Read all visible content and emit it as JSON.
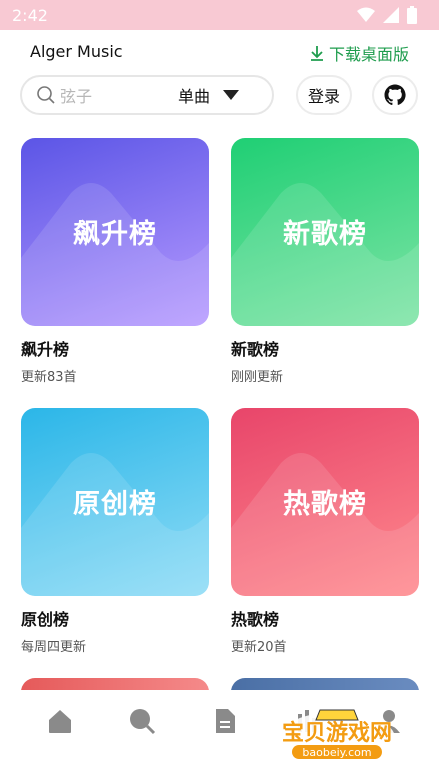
{
  "status": {
    "time": "2:42"
  },
  "app": {
    "title": "Alger Music",
    "download_label": "下载桌面版"
  },
  "search": {
    "placeholder": "弦子",
    "type_label": "单曲"
  },
  "actions": {
    "login_label": "登录",
    "github_icon": "github-icon"
  },
  "charts": [
    {
      "cover_label": "飙升榜",
      "title": "飙升榜",
      "subtitle": "更新83首",
      "gradient": [
        "#5b55e6",
        "#b79bff"
      ]
    },
    {
      "cover_label": "新歌榜",
      "title": "新歌榜",
      "subtitle": "刚刚更新",
      "gradient": [
        "#1fcf74",
        "#7fe4a6"
      ]
    },
    {
      "cover_label": "原创榜",
      "title": "原创榜",
      "subtitle": "每周四更新",
      "gradient": [
        "#2bb6e8",
        "#8fdcf6"
      ]
    },
    {
      "cover_label": "热歌榜",
      "title": "热歌榜",
      "subtitle": "更新20首",
      "gradient": [
        "#e8456a",
        "#ff8a8e"
      ]
    }
  ],
  "nav": [
    "home-icon",
    "search-icon",
    "document-icon",
    "music-icon",
    "user-icon"
  ],
  "watermark": {
    "text": "宝贝游戏网",
    "url": "baobeiy.com"
  }
}
